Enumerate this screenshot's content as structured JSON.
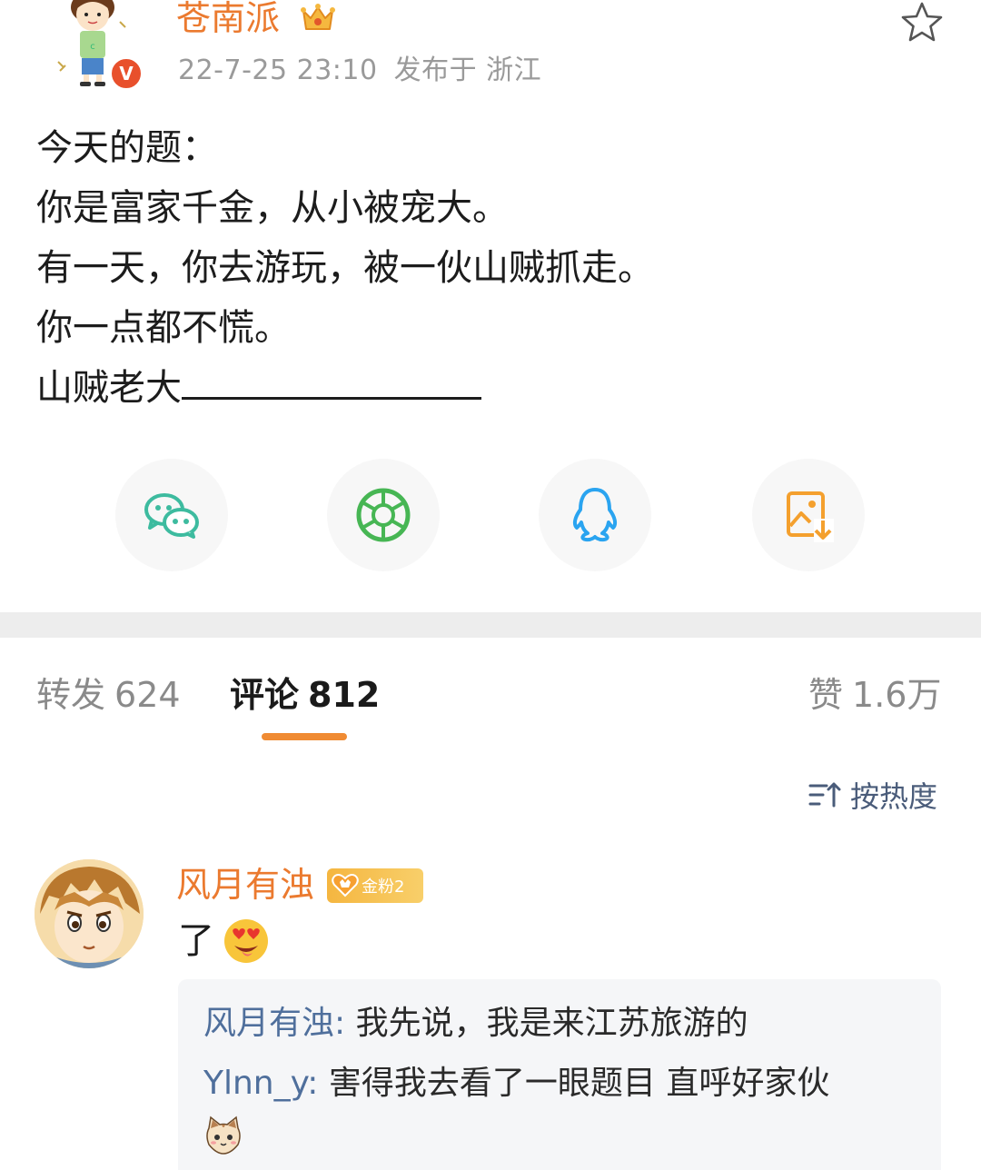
{
  "post": {
    "author": "苍南派",
    "date": "22-7-25 23:10",
    "location_prefix": "发布于",
    "location": "浙江",
    "lines": [
      "今天的题：",
      "你是富家千金，从小被宠大。",
      "有一天，你去游玩，被一伙山贼抓走。",
      "你一点都不慌。",
      "山贼老大"
    ]
  },
  "share": {
    "icons": [
      "wechat-icon",
      "moments-icon",
      "qq-icon",
      "save-image-icon"
    ],
    "colors": {
      "wechat": "#3dbb9f",
      "moments": "#47b654",
      "qq": "#2aa4f0",
      "save": "#f4a02e"
    }
  },
  "tabs": {
    "repost_label": "转发",
    "repost_count": "624",
    "comment_label": "评论",
    "comment_count": "812",
    "like_label": "赞",
    "like_count": "1.6万"
  },
  "sort": {
    "label": "按热度"
  },
  "comment": {
    "user": "风月有浊",
    "badge": "金粉2",
    "text": "了",
    "replies": [
      {
        "user": "风月有浊:",
        "text": " 我先说，我是来江苏旅游的"
      },
      {
        "user": "Ylnn_y:",
        "text": " 害得我去看了一眼题目 直呼好家伙"
      }
    ]
  },
  "colors": {
    "accent": "#eb7a2f",
    "link": "#4f6f9c",
    "underline": "#f08b33"
  }
}
